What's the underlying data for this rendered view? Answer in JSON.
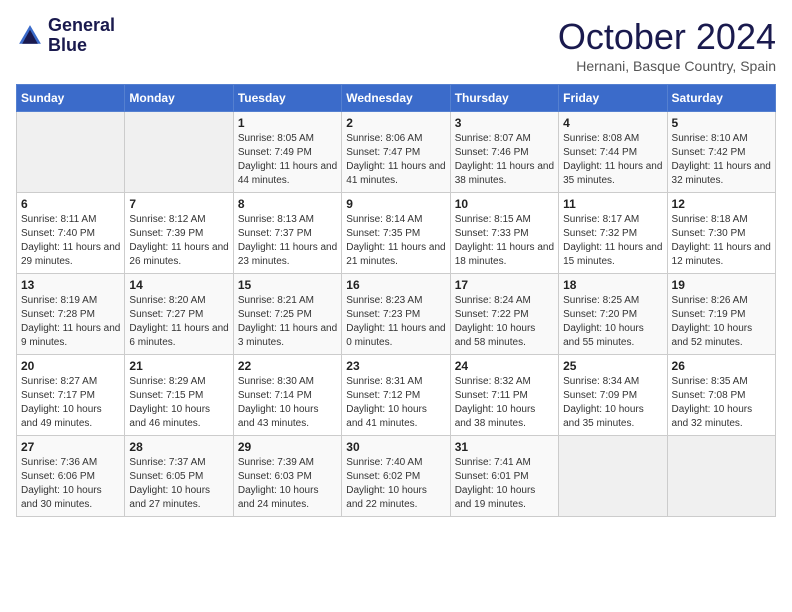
{
  "header": {
    "logo_line1": "General",
    "logo_line2": "Blue",
    "month_title": "October 2024",
    "subtitle": "Hernani, Basque Country, Spain"
  },
  "weekdays": [
    "Sunday",
    "Monday",
    "Tuesday",
    "Wednesday",
    "Thursday",
    "Friday",
    "Saturday"
  ],
  "weeks": [
    [
      {
        "day": "",
        "info": ""
      },
      {
        "day": "",
        "info": ""
      },
      {
        "day": "1",
        "info": "Sunrise: 8:05 AM\nSunset: 7:49 PM\nDaylight: 11 hours and 44 minutes."
      },
      {
        "day": "2",
        "info": "Sunrise: 8:06 AM\nSunset: 7:47 PM\nDaylight: 11 hours and 41 minutes."
      },
      {
        "day": "3",
        "info": "Sunrise: 8:07 AM\nSunset: 7:46 PM\nDaylight: 11 hours and 38 minutes."
      },
      {
        "day": "4",
        "info": "Sunrise: 8:08 AM\nSunset: 7:44 PM\nDaylight: 11 hours and 35 minutes."
      },
      {
        "day": "5",
        "info": "Sunrise: 8:10 AM\nSunset: 7:42 PM\nDaylight: 11 hours and 32 minutes."
      }
    ],
    [
      {
        "day": "6",
        "info": "Sunrise: 8:11 AM\nSunset: 7:40 PM\nDaylight: 11 hours and 29 minutes."
      },
      {
        "day": "7",
        "info": "Sunrise: 8:12 AM\nSunset: 7:39 PM\nDaylight: 11 hours and 26 minutes."
      },
      {
        "day": "8",
        "info": "Sunrise: 8:13 AM\nSunset: 7:37 PM\nDaylight: 11 hours and 23 minutes."
      },
      {
        "day": "9",
        "info": "Sunrise: 8:14 AM\nSunset: 7:35 PM\nDaylight: 11 hours and 21 minutes."
      },
      {
        "day": "10",
        "info": "Sunrise: 8:15 AM\nSunset: 7:33 PM\nDaylight: 11 hours and 18 minutes."
      },
      {
        "day": "11",
        "info": "Sunrise: 8:17 AM\nSunset: 7:32 PM\nDaylight: 11 hours and 15 minutes."
      },
      {
        "day": "12",
        "info": "Sunrise: 8:18 AM\nSunset: 7:30 PM\nDaylight: 11 hours and 12 minutes."
      }
    ],
    [
      {
        "day": "13",
        "info": "Sunrise: 8:19 AM\nSunset: 7:28 PM\nDaylight: 11 hours and 9 minutes."
      },
      {
        "day": "14",
        "info": "Sunrise: 8:20 AM\nSunset: 7:27 PM\nDaylight: 11 hours and 6 minutes."
      },
      {
        "day": "15",
        "info": "Sunrise: 8:21 AM\nSunset: 7:25 PM\nDaylight: 11 hours and 3 minutes."
      },
      {
        "day": "16",
        "info": "Sunrise: 8:23 AM\nSunset: 7:23 PM\nDaylight: 11 hours and 0 minutes."
      },
      {
        "day": "17",
        "info": "Sunrise: 8:24 AM\nSunset: 7:22 PM\nDaylight: 10 hours and 58 minutes."
      },
      {
        "day": "18",
        "info": "Sunrise: 8:25 AM\nSunset: 7:20 PM\nDaylight: 10 hours and 55 minutes."
      },
      {
        "day": "19",
        "info": "Sunrise: 8:26 AM\nSunset: 7:19 PM\nDaylight: 10 hours and 52 minutes."
      }
    ],
    [
      {
        "day": "20",
        "info": "Sunrise: 8:27 AM\nSunset: 7:17 PM\nDaylight: 10 hours and 49 minutes."
      },
      {
        "day": "21",
        "info": "Sunrise: 8:29 AM\nSunset: 7:15 PM\nDaylight: 10 hours and 46 minutes."
      },
      {
        "day": "22",
        "info": "Sunrise: 8:30 AM\nSunset: 7:14 PM\nDaylight: 10 hours and 43 minutes."
      },
      {
        "day": "23",
        "info": "Sunrise: 8:31 AM\nSunset: 7:12 PM\nDaylight: 10 hours and 41 minutes."
      },
      {
        "day": "24",
        "info": "Sunrise: 8:32 AM\nSunset: 7:11 PM\nDaylight: 10 hours and 38 minutes."
      },
      {
        "day": "25",
        "info": "Sunrise: 8:34 AM\nSunset: 7:09 PM\nDaylight: 10 hours and 35 minutes."
      },
      {
        "day": "26",
        "info": "Sunrise: 8:35 AM\nSunset: 7:08 PM\nDaylight: 10 hours and 32 minutes."
      }
    ],
    [
      {
        "day": "27",
        "info": "Sunrise: 7:36 AM\nSunset: 6:06 PM\nDaylight: 10 hours and 30 minutes."
      },
      {
        "day": "28",
        "info": "Sunrise: 7:37 AM\nSunset: 6:05 PM\nDaylight: 10 hours and 27 minutes."
      },
      {
        "day": "29",
        "info": "Sunrise: 7:39 AM\nSunset: 6:03 PM\nDaylight: 10 hours and 24 minutes."
      },
      {
        "day": "30",
        "info": "Sunrise: 7:40 AM\nSunset: 6:02 PM\nDaylight: 10 hours and 22 minutes."
      },
      {
        "day": "31",
        "info": "Sunrise: 7:41 AM\nSunset: 6:01 PM\nDaylight: 10 hours and 19 minutes."
      },
      {
        "day": "",
        "info": ""
      },
      {
        "day": "",
        "info": ""
      }
    ]
  ]
}
